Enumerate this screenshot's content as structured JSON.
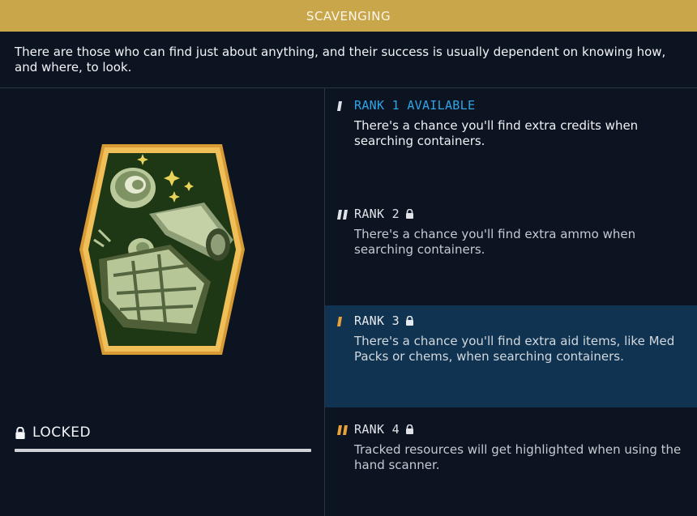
{
  "header": {
    "title": "SCAVENGING"
  },
  "description": "There are those who can find just about anything, and their success is usually dependent on knowing how, and where, to look.",
  "skill": {
    "status_label": "LOCKED",
    "progress_fraction": 1.0
  },
  "ranks": [
    {
      "title": "RANK 1 AVAILABLE",
      "text": "There's a chance you'll find extra credits when searching containers.",
      "state": "available",
      "selected": false
    },
    {
      "title": "RANK 2",
      "text": "There's a chance you'll find extra ammo when searching containers.",
      "state": "locked",
      "selected": false
    },
    {
      "title": "RANK 3",
      "text": "There's a chance you'll find extra aid items, like Med Packs or chems, when searching containers.",
      "state": "locked",
      "selected": true
    },
    {
      "title": "RANK 4",
      "text": "Tracked resources will get highlighted when using the hand scanner.",
      "state": "locked",
      "selected": false
    }
  ],
  "colors": {
    "header": "#c9a64a",
    "background": "#0c1422",
    "available": "#2fa5e6",
    "rank_accent": "#e9a13a",
    "selected_row": "#0f3350",
    "badge_border": "#e8b04a",
    "badge_fill": "#1f3a16"
  },
  "icons": {
    "badge": "scavenging-badge-icon",
    "lock": "lock-icon",
    "rank_marker": "rank-tally-icon"
  }
}
